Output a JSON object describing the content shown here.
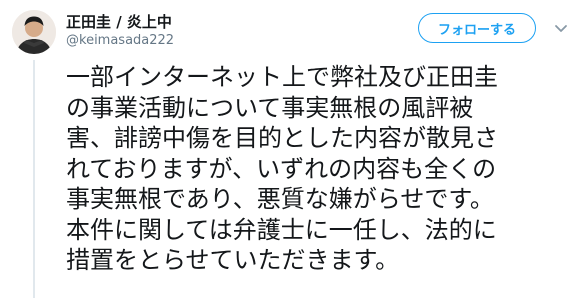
{
  "tweet": {
    "author": {
      "display_name": "正田圭 / 炎上中",
      "screen_name": "@keimasada222",
      "avatar": "person-photo"
    },
    "follow_label": "フォローする",
    "menu_icon": "chevron-down-icon",
    "text_lines": [
      "一部インターネット上で弊社及び正田圭",
      "の事業活動について事実無根の風評被",
      "害、誹謗中傷を目的とした内容が散見さ",
      "れておりますが、いずれの内容も全くの",
      "事実無根であり、悪質な嫌がらせです。",
      "本件に関しては弁護士に一任し、法的に",
      "措置をとらせていただきます。"
    ]
  },
  "colors": {
    "accent": "#1da1f2",
    "text": "#14171a",
    "muted": "#657786",
    "thread_line": "#e1e8ed"
  }
}
